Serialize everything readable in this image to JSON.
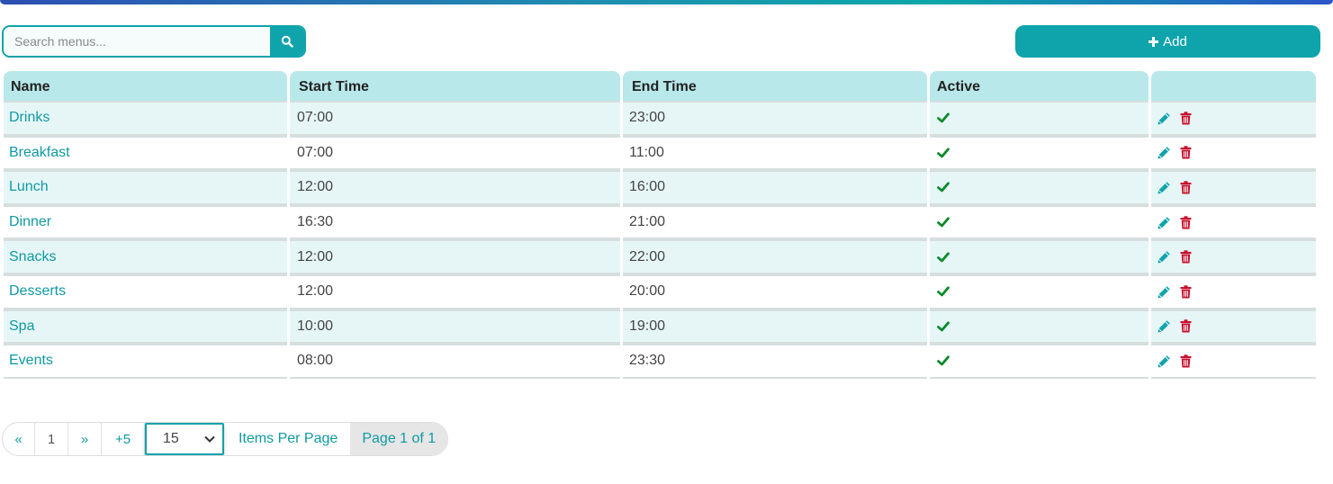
{
  "search": {
    "placeholder": "Search menus..."
  },
  "toolbar": {
    "add_label": "Add"
  },
  "table": {
    "columns": [
      "Name",
      "Start Time",
      "End Time",
      "Active",
      ""
    ],
    "rows": [
      {
        "name": "Drinks",
        "start": "07:00",
        "end": "23:00",
        "active": true
      },
      {
        "name": "Breakfast",
        "start": "07:00",
        "end": "11:00",
        "active": true
      },
      {
        "name": "Lunch",
        "start": "12:00",
        "end": "16:00",
        "active": true
      },
      {
        "name": "Dinner",
        "start": "16:30",
        "end": "21:00",
        "active": true
      },
      {
        "name": "Snacks",
        "start": "12:00",
        "end": "22:00",
        "active": true
      },
      {
        "name": "Desserts",
        "start": "12:00",
        "end": "20:00",
        "active": true
      },
      {
        "name": "Spa",
        "start": "10:00",
        "end": "19:00",
        "active": true
      },
      {
        "name": "Events",
        "start": "08:00",
        "end": "23:30",
        "active": true
      }
    ]
  },
  "pagination": {
    "prev_label": "«",
    "current_page": "1",
    "next_label": "»",
    "jump_label": "+5",
    "per_page_value": "15",
    "per_page_label": "Items Per Page",
    "page_info": "Page 1 of 1"
  },
  "colors": {
    "accent": "#0fa3ab",
    "check": "#0a8a2a",
    "delete": "#c8102e",
    "header_bg": "#b8e8ea",
    "row_alt_bg": "#e6f6f7"
  },
  "icons": {
    "search": "search-icon",
    "add": "plus-icon",
    "active": "check-icon",
    "edit": "pencil-icon",
    "delete": "trash-icon",
    "select": "chevron-down-icon"
  }
}
